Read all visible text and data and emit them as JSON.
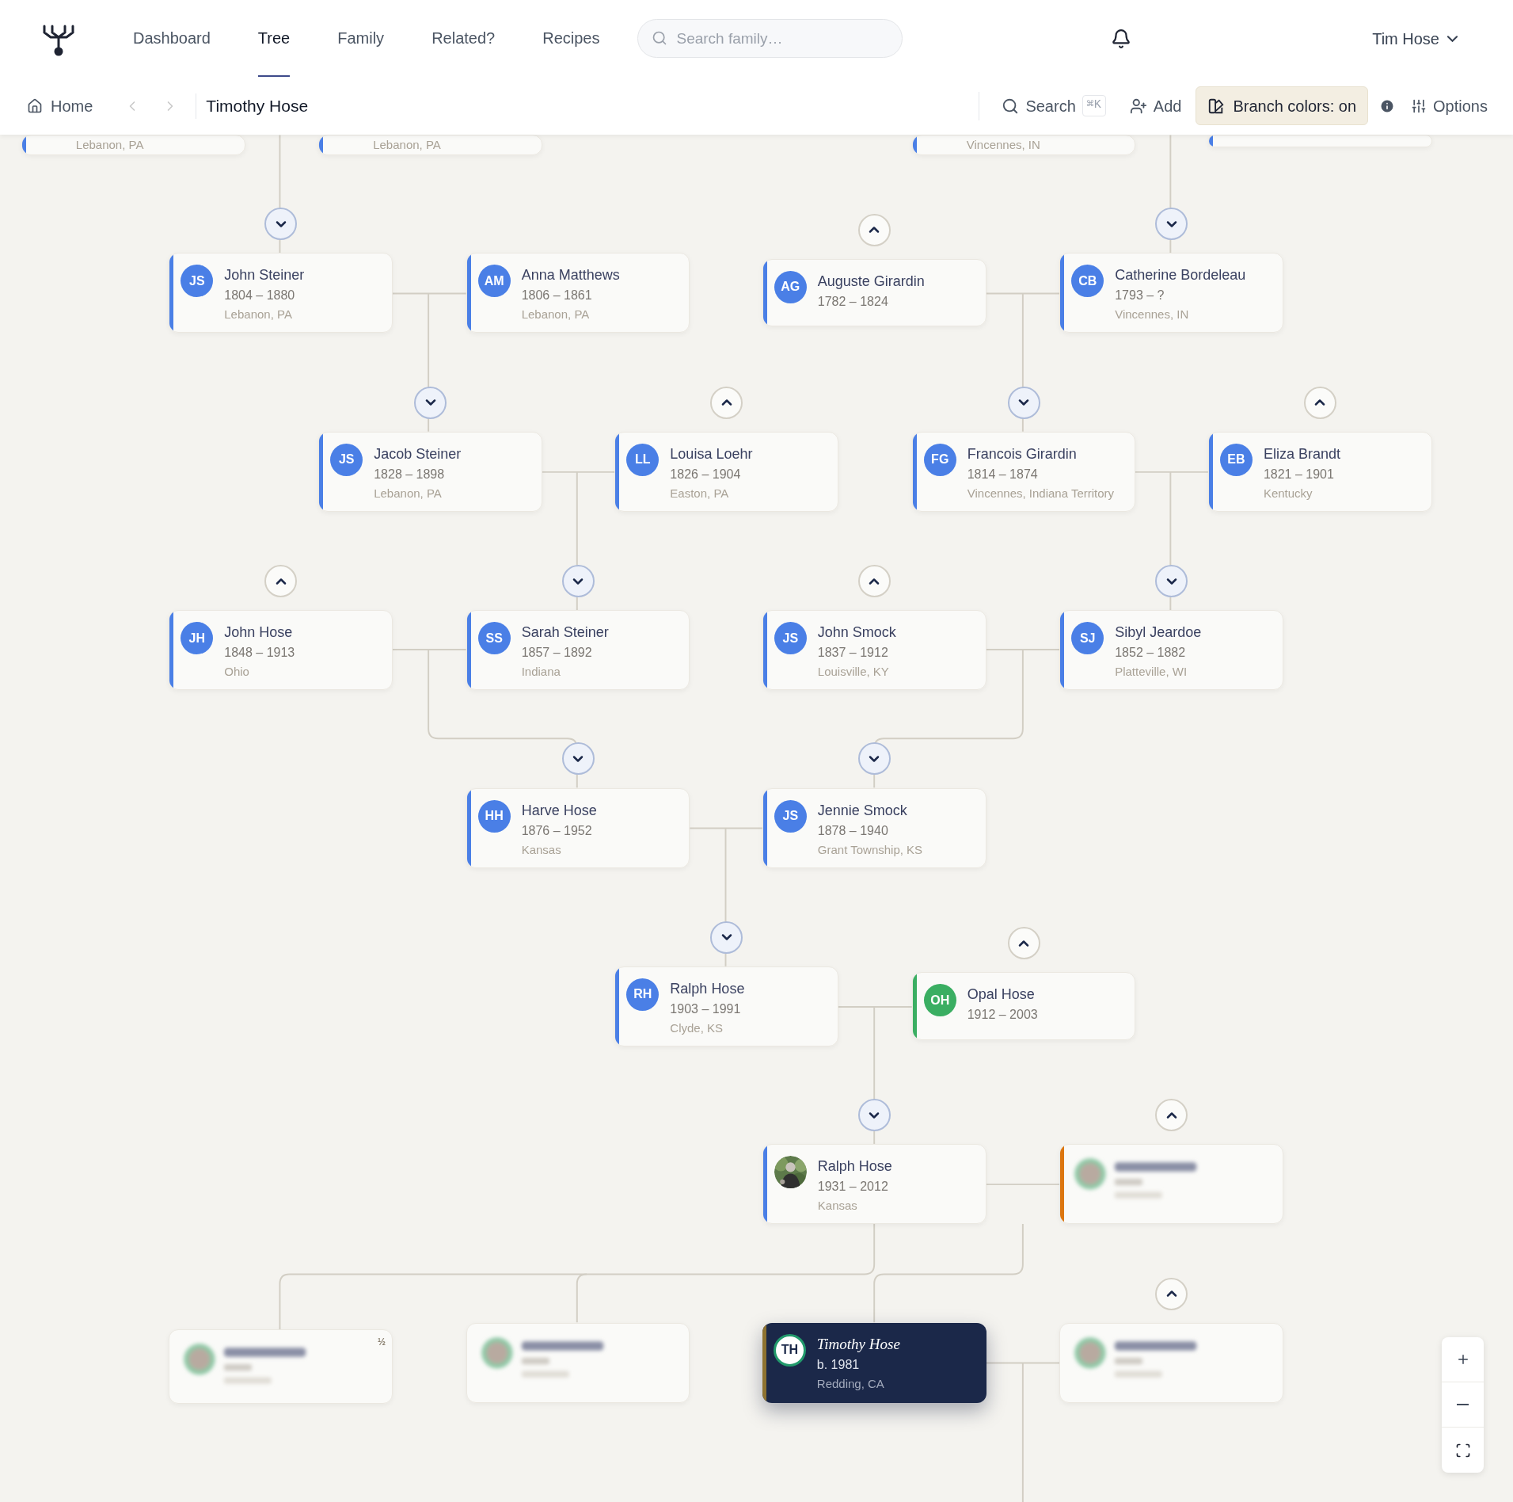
{
  "nav": [
    {
      "label": "Dashboard",
      "selected": false
    },
    {
      "label": "Tree",
      "selected": true
    },
    {
      "label": "Family",
      "selected": false
    },
    {
      "label": "Related?",
      "selected": false
    },
    {
      "label": "Recipes",
      "selected": false
    }
  ],
  "search": {
    "placeholder": "Search family…"
  },
  "user": "Tim Hose",
  "breadcrumb": {
    "home": "Home",
    "back_disabled": true,
    "forward_disabled": true,
    "current": "Timothy Hose"
  },
  "toolbar": {
    "search": "Search",
    "shortcut": "⌘K",
    "add": "Add",
    "branch_colors": {
      "label": "Branch colors: on",
      "on": true
    },
    "options": "Options"
  },
  "cards": [
    {
      "kind": "person",
      "selected": false,
      "color": "#4a7fe6",
      "place": "Lebanon, PA"
    },
    {
      "kind": "person",
      "selected": false,
      "color": "#4a7fe6",
      "place": "Lebanon, PA"
    },
    {
      "kind": "person",
      "selected": false,
      "color": "#4a7fe6",
      "place": "Vincennes, IN"
    },
    {
      "kind": "person",
      "selected": false,
      "color": "#4a7fe6"
    },
    {
      "kind": "person",
      "selected": false,
      "color": "#4a7fe6",
      "initials": "JS",
      "name": "John Steiner",
      "dates": "1804 – 1880",
      "place": "Lebanon, PA",
      "parents_expanded": true
    },
    {
      "kind": "person",
      "selected": false,
      "color": "#4a7fe6",
      "initials": "AM",
      "name": "Anna Matthews",
      "dates": "1806 – 1861",
      "place": "Lebanon, PA"
    },
    {
      "kind": "person",
      "selected": false,
      "color": "#4a7fe6",
      "initials": "AG",
      "name": "Auguste Girardin",
      "dates": "1782 – 1824",
      "parents_expanded": false
    },
    {
      "kind": "person",
      "selected": false,
      "color": "#4a7fe6",
      "initials": "CB",
      "name": "Catherine Bordeleau",
      "dates": "1793 – ?",
      "place": "Vincennes, IN",
      "parents_expanded": true
    },
    {
      "kind": "person",
      "selected": false,
      "color": "#4a7fe6",
      "initials": "JS",
      "name": "Jacob Steiner",
      "dates": "1828 – 1898",
      "place": "Lebanon, PA",
      "parents_expanded": true
    },
    {
      "kind": "person",
      "selected": false,
      "color": "#4a7fe6",
      "initials": "LL",
      "name": "Louisa Loehr",
      "dates": "1826 – 1904",
      "place": "Easton, PA",
      "parents_expanded": false
    },
    {
      "kind": "person",
      "selected": false,
      "color": "#4a7fe6",
      "initials": "FG",
      "name": "Francois Girardin",
      "dates": "1814 – 1874",
      "place": "Vincennes, Indiana Territory",
      "parents_expanded": true
    },
    {
      "kind": "person",
      "selected": false,
      "color": "#4a7fe6",
      "initials": "EB",
      "name": "Eliza Brandt",
      "dates": "1821 – 1901",
      "place": "Kentucky",
      "parents_expanded": false
    },
    {
      "kind": "person",
      "selected": false,
      "color": "#4a7fe6",
      "initials": "JH",
      "name": "John Hose",
      "dates": "1848 – 1913",
      "place": "Ohio",
      "parents_expanded": false
    },
    {
      "kind": "person",
      "selected": false,
      "color": "#4a7fe6",
      "initials": "SS",
      "name": "Sarah Steiner",
      "dates": "1857 – 1892",
      "place": "Indiana",
      "parents_expanded": true
    },
    {
      "kind": "person",
      "selected": false,
      "color": "#4a7fe6",
      "initials": "JS",
      "name": "John Smock",
      "dates": "1837 – 1912",
      "place": "Louisville, KY",
      "parents_expanded": false
    },
    {
      "kind": "person",
      "selected": false,
      "color": "#4a7fe6",
      "initials": "SJ",
      "name": "Sibyl Jeardoe",
      "dates": "1852 – 1882",
      "place": "Platteville, WI",
      "parents_expanded": true
    },
    {
      "kind": "person",
      "selected": false,
      "color": "#4a7fe6",
      "initials": "HH",
      "name": "Harve Hose",
      "dates": "1876 – 1952",
      "place": "Kansas",
      "parents_expanded": true
    },
    {
      "kind": "person",
      "selected": false,
      "color": "#4a7fe6",
      "initials": "JS",
      "name": "Jennie Smock",
      "dates": "1878 – 1940",
      "place": "Grant Township, KS",
      "parents_expanded": true
    },
    {
      "kind": "person",
      "selected": false,
      "color": "#4a7fe6",
      "initials": "RH",
      "name": "Ralph Hose",
      "dates": "1903 – 1991",
      "place": "Clyde, KS",
      "parents_expanded": true
    },
    {
      "kind": "person",
      "selected": false,
      "color": "#3aae62",
      "initials": "OH",
      "name": "Opal Hose",
      "dates": "1912 – 2003",
      "parents_expanded": false
    },
    {
      "kind": "person",
      "selected": false,
      "color": "#4a7fe6",
      "photo": true,
      "name": "Ralph Hose",
      "dates": "1931 – 2012",
      "place": "Kansas",
      "parents_expanded": true
    },
    {
      "kind": "blurred",
      "selected": false,
      "color": "#dc7610",
      "parents_expanded": false
    },
    {
      "kind": "blurred",
      "selected": false,
      "badge": "½"
    },
    {
      "kind": "blurred",
      "selected": false
    },
    {
      "kind": "person",
      "selected": true,
      "color": "#8d7230",
      "initials": "TH",
      "name": "Timothy Hose",
      "dates": "b. 1981",
      "place": "Redding, CA"
    },
    {
      "kind": "blurred",
      "selected": false,
      "parents_expanded": false
    }
  ]
}
